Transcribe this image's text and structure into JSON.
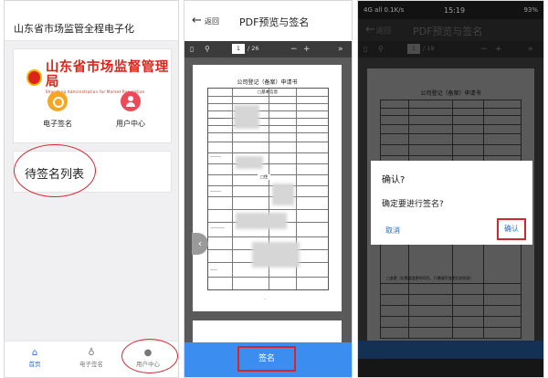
{
  "panel1": {
    "header_title": "山东省市场监管全程电子化",
    "logo": {
      "name_cn": "山东省市场监督管理局",
      "name_en": "Shandong Administration for Market Regulation"
    },
    "icons": [
      {
        "label": "电子签名",
        "icon": "seal-icon"
      },
      {
        "label": "用户中心",
        "icon": "user-icon"
      }
    ],
    "pending_title": "待签名列表",
    "tabs": [
      {
        "label": "首页",
        "icon": "home-icon",
        "active": true
      },
      {
        "label": "电子签名",
        "icon": "signature-icon",
        "active": false
      },
      {
        "label": "用户中心",
        "icon": "person-icon",
        "active": false
      }
    ]
  },
  "panel2": {
    "back_label": "返回",
    "title": "PDF预览与签名",
    "page_current": "1",
    "page_total": "/ 26",
    "doc_title": "公司登记（备案）申请书",
    "doc_section": "□基本信息",
    "doc_mark": "□住",
    "sign_button": "签名",
    "accent_color": "#3b8ef0"
  },
  "panel3": {
    "status_left": "4G all 0.1K/s",
    "status_time": "15:19",
    "status_right": "93%",
    "back_label": "返回",
    "title": "PDF预览与签名",
    "page_current": "1",
    "page_total": "/ 19",
    "doc_title": "公司登记（备案）申请书",
    "doc_footer": "□变更（仅需要变更的项目，只需填写变更后的信息）",
    "dialog": {
      "title": "确认?",
      "message": "确定要进行签名?",
      "cancel": "取消",
      "confirm": "确认"
    }
  },
  "annotation_color": "#d4262f"
}
